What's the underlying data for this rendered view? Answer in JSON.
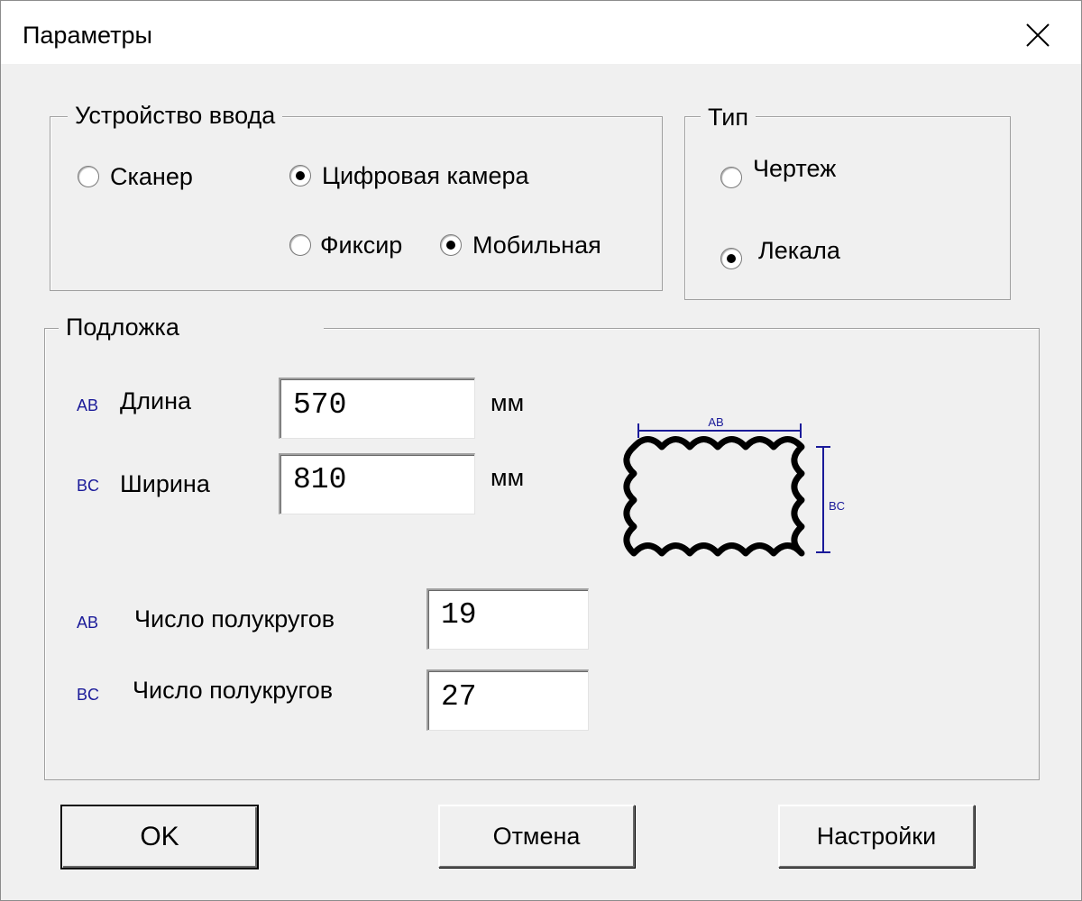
{
  "window": {
    "title": "Параметры",
    "close_icon": "close-icon"
  },
  "input_device": {
    "legend": "Устройство ввода",
    "scanner": {
      "label": "Сканер",
      "checked": false
    },
    "digital_camera": {
      "label": "Цифровая камера",
      "checked": true
    },
    "fixed": {
      "label": "Фиксир",
      "checked": false
    },
    "mobile": {
      "label": "Мобильная",
      "checked": true
    }
  },
  "type": {
    "legend": "Тип",
    "drawing": {
      "label": "Чертеж",
      "checked": false
    },
    "patterns": {
      "label": "Лекала",
      "checked": true
    }
  },
  "substrate": {
    "legend": "Подложка",
    "length": {
      "tag": "AB",
      "label": "Длина",
      "value": "570",
      "unit": "мм"
    },
    "width": {
      "tag": "BC",
      "label": "Ширина",
      "value": "810",
      "unit": "мм"
    },
    "semicircles_ab": {
      "tag": "AB",
      "label": "Число полукругов",
      "value": "19"
    },
    "semicircles_bc": {
      "tag": "BC",
      "label": "Число полукругов",
      "value": "27"
    },
    "preview": {
      "top_tag": "AB",
      "side_tag": "BC",
      "accent": "#1a1a99"
    }
  },
  "buttons": {
    "ok": "OK",
    "cancel": "Отмена",
    "settings": "Настройки"
  }
}
